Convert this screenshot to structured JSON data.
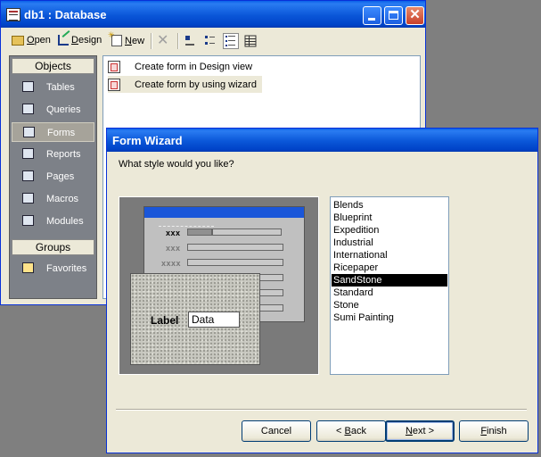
{
  "db_window": {
    "title": "db1 : Database",
    "toolbar": {
      "open_pre": "",
      "open_u": "O",
      "open_post": "pen",
      "design_pre": "",
      "design_u": "D",
      "design_post": "esign",
      "new_pre": "",
      "new_u": "N",
      "new_post": "ew"
    },
    "objects_header": "Objects",
    "objects": [
      {
        "label": "Tables",
        "icon": "table-icon"
      },
      {
        "label": "Queries",
        "icon": "query-icon"
      },
      {
        "label": "Forms",
        "icon": "form-icon",
        "active": true
      },
      {
        "label": "Reports",
        "icon": "report-icon"
      },
      {
        "label": "Pages",
        "icon": "page-icon"
      },
      {
        "label": "Macros",
        "icon": "macro-icon"
      },
      {
        "label": "Modules",
        "icon": "module-icon"
      }
    ],
    "groups_header": "Groups",
    "groups": [
      {
        "label": "Favorites",
        "icon": "favorites-icon"
      }
    ],
    "list_items": [
      {
        "label": "Create form in Design view"
      },
      {
        "label": "Create form by using wizard",
        "selected": true
      }
    ]
  },
  "wizard": {
    "title": "Form Wizard",
    "question": "What style would you like?",
    "preview": {
      "row_labels": [
        "xxx",
        "xxx",
        "xxxx"
      ],
      "zoom_label": "Label",
      "zoom_value": "Data"
    },
    "styles": [
      "Blends",
      "Blueprint",
      "Expedition",
      "Industrial",
      "International",
      "Ricepaper",
      "SandStone",
      "Standard",
      "Stone",
      "Sumi Painting"
    ],
    "selected_style": "SandStone",
    "buttons": {
      "cancel": "Cancel",
      "back_pre": "< ",
      "back_u": "B",
      "back_post": "ack",
      "next_pre": "",
      "next_u": "N",
      "next_post": "ext >",
      "finish_pre": "",
      "finish_u": "F",
      "finish_post": "inish"
    }
  }
}
